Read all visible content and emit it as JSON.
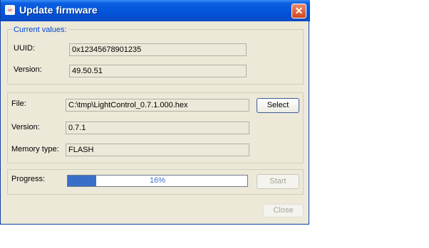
{
  "window": {
    "title": "Update firmware",
    "title_icon": "java-cup-icon",
    "close_glyph": "✕"
  },
  "current": {
    "legend": "Current values:",
    "uuid_label": "UUID:",
    "uuid_value": "0x12345678901235",
    "version_label": "Version:",
    "version_value": "49.50.51"
  },
  "file": {
    "file_label": "File:",
    "file_value": "C:\\tmp\\LightControl_0.7.1.000.hex",
    "select_label": "Select",
    "version_label": "Version:",
    "version_value": "0.7.1",
    "memory_label": "Memory type:",
    "memory_value": "FLASH"
  },
  "progress": {
    "label": "Progress:",
    "value": 0.16,
    "text": "16%",
    "start_label": "Start"
  },
  "footer": {
    "close_label": "Close"
  },
  "colors": {
    "titlebar": "#0253d8",
    "accent": "#3a6fc8",
    "legend": "#0046d5",
    "window_bg": "#ece9d8"
  }
}
